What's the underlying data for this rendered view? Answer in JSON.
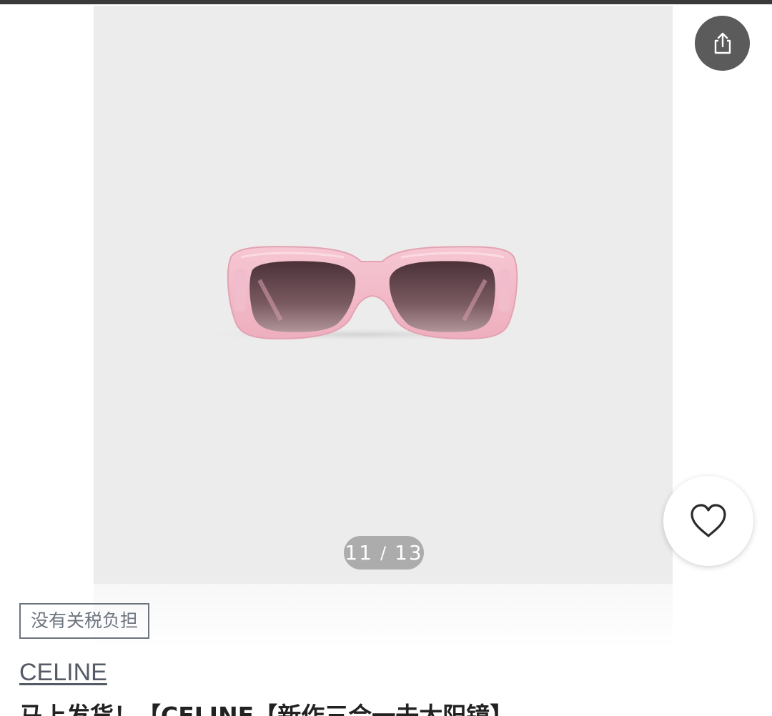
{
  "gallery": {
    "current_index": "11",
    "separator": "/",
    "total": "13"
  },
  "tag": {
    "label": "没有关税负担"
  },
  "product": {
    "brand": "CELINE",
    "title": "马上发货！【CELINE【新作三合一去太阳镜】"
  },
  "icons": {
    "share": "share-icon",
    "favorite": "heart-icon"
  },
  "colors": {
    "top_bar": "#3a3a3a",
    "share_button_bg": "#5b5b5b",
    "frame_pink": "#f3b9c8",
    "lens_dark": "#5a3e46",
    "tag_border": "#6d7480",
    "brand_text": "#555b66"
  }
}
